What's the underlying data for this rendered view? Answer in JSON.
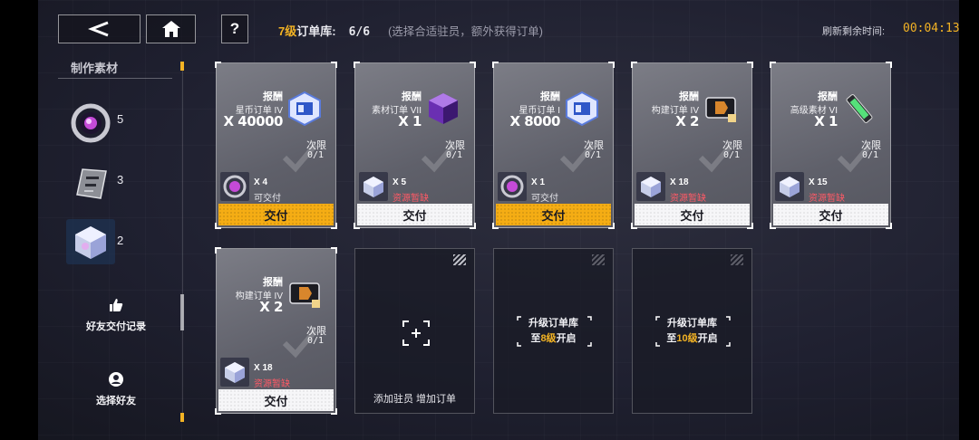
{
  "header": {
    "order_level": "7级",
    "title_suffix": "订单库:",
    "count": "6/6",
    "hint": "(选择合适驻员，额外获得订单)",
    "timer_label": "刷新剩余时间:",
    "timer_value": "00:04:13",
    "help_label": "?"
  },
  "sidebar": {
    "heading": "制作素材",
    "materials": [
      {
        "icon": "purple-orb-material-icon",
        "count": "5"
      },
      {
        "icon": "metal-plate-material-icon",
        "count": "3"
      },
      {
        "icon": "crystal-cube-material-icon",
        "count": "2"
      }
    ],
    "friend_records": "好友交付记录",
    "select_friend": "选择好友"
  },
  "orders": [
    {
      "reward_label": "报酬",
      "reward_name": "星币订单 IV",
      "reward_qty": "X 40000",
      "reward_icon": "star-coin-chip-icon",
      "limit_label": "次限",
      "limit_value": "0/1",
      "req_icon": "purple-orb-material-icon",
      "req_qty": "X 4",
      "req_status": "可交付",
      "req_ok": true,
      "deliver": "交付"
    },
    {
      "reward_label": "报酬",
      "reward_name": "素材订单 VII",
      "reward_qty": "X 1",
      "reward_icon": "purple-cube-icon",
      "limit_label": "次限",
      "limit_value": "0/1",
      "req_icon": "crystal-cube-material-icon",
      "req_qty": "X 5",
      "req_status": "资源暂缺",
      "req_ok": false,
      "deliver": "交付"
    },
    {
      "reward_label": "报酬",
      "reward_name": "星币订单 I",
      "reward_qty": "X 8000",
      "reward_icon": "star-coin-chip-icon",
      "limit_label": "次限",
      "limit_value": "0/1",
      "req_icon": "purple-orb-material-icon",
      "req_qty": "X 1",
      "req_status": "可交付",
      "req_ok": true,
      "deliver": "交付"
    },
    {
      "reward_label": "报酬",
      "reward_name": "构建订单 IV",
      "reward_qty": "X 2",
      "reward_icon": "build-ticket-icon",
      "limit_label": "次限",
      "limit_value": "0/1",
      "req_icon": "crystal-cube-material-icon",
      "req_qty": "X 18",
      "req_status": "资源暂缺",
      "req_ok": false,
      "deliver": "交付"
    },
    {
      "reward_label": "报酬",
      "reward_name": "高级素材 VI",
      "reward_qty": "X 1",
      "reward_icon": "green-vial-icon",
      "limit_label": "次限",
      "limit_value": "0/1",
      "req_icon": "crystal-cube-material-icon",
      "req_qty": "X 15",
      "req_status": "资源暂缺",
      "req_ok": false,
      "deliver": "交付"
    },
    {
      "reward_label": "报酬",
      "reward_name": "构建订单 IV",
      "reward_qty": "X 2",
      "reward_icon": "build-ticket-icon",
      "limit_label": "次限",
      "limit_value": "0/1",
      "req_icon": "crystal-cube-material-icon",
      "req_qty": "X 18",
      "req_status": "资源暂缺",
      "req_ok": false,
      "deliver": "交付"
    }
  ],
  "slots": {
    "add_text": "添加驻员 增加订单",
    "lock1_line1": "升级订单库",
    "lock1_pre": "至",
    "lock1_level": "8级",
    "lock1_post": "开启",
    "lock2_line1": "升级订单库",
    "lock2_pre": "至",
    "lock2_level": "10级",
    "lock2_post": "开启"
  }
}
